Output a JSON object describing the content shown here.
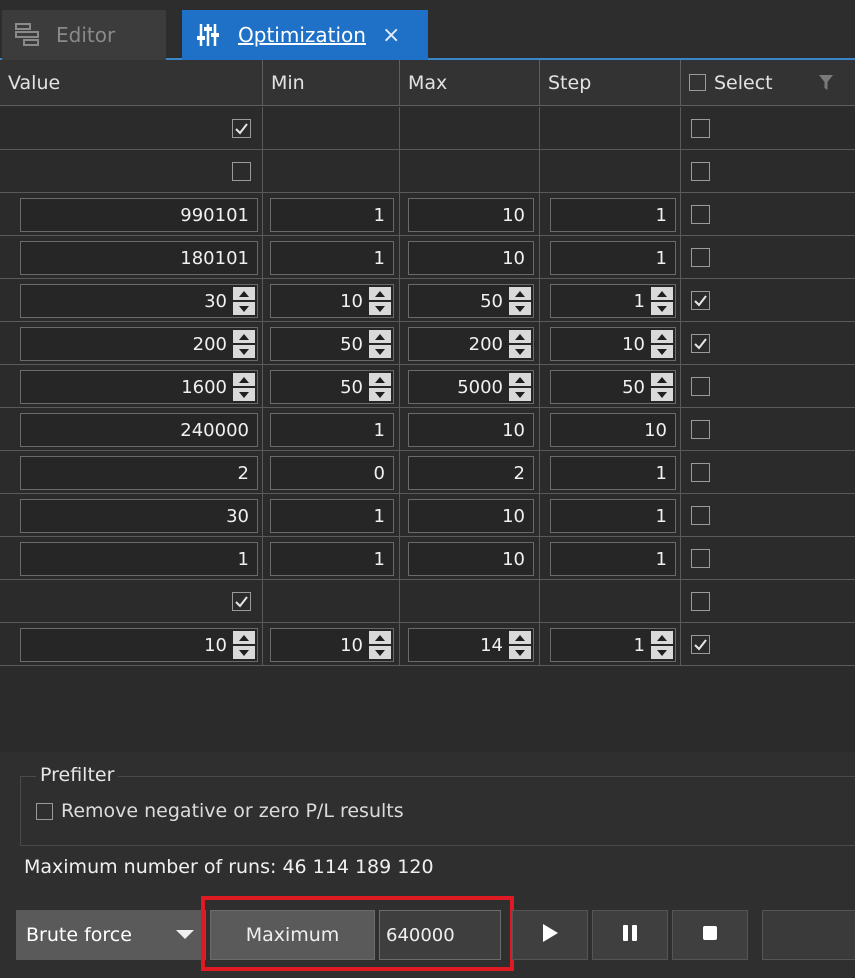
{
  "tabs": [
    {
      "label": "Editor",
      "icon": "editor-icon",
      "active": false
    },
    {
      "label": "Optimization",
      "icon": "sliders-icon",
      "active": true,
      "close": "×"
    }
  ],
  "columns": {
    "value": "Value",
    "min": "Min",
    "max": "Max",
    "step": "Step",
    "select": "Select"
  },
  "rows": [
    {
      "kind": "bool",
      "value": true,
      "select": false
    },
    {
      "kind": "bool",
      "value": false,
      "select": false
    },
    {
      "kind": "num",
      "value": "990101",
      "min": "1",
      "max": "10",
      "step": "1",
      "select": false,
      "spin": false
    },
    {
      "kind": "num",
      "value": "180101",
      "min": "1",
      "max": "10",
      "step": "1",
      "select": false,
      "spin": false
    },
    {
      "kind": "num",
      "value": "30",
      "min": "10",
      "max": "50",
      "step": "1",
      "select": true,
      "spin": true
    },
    {
      "kind": "num",
      "value": "200",
      "min": "50",
      "max": "200",
      "step": "10",
      "select": true,
      "spin": true
    },
    {
      "kind": "num",
      "value": "1600",
      "min": "50",
      "max": "5000",
      "step": "50",
      "select": false,
      "spin": true
    },
    {
      "kind": "num",
      "value": "240000",
      "min": "1",
      "max": "10",
      "step": "10",
      "select": false,
      "spin": false
    },
    {
      "kind": "num",
      "value": "2",
      "min": "0",
      "max": "2",
      "step": "1",
      "select": false,
      "spin": false
    },
    {
      "kind": "num",
      "value": "30",
      "min": "1",
      "max": "10",
      "step": "1",
      "select": false,
      "spin": false
    },
    {
      "kind": "num",
      "value": "1",
      "min": "1",
      "max": "10",
      "step": "1",
      "select": false,
      "spin": false
    },
    {
      "kind": "bool",
      "value": true,
      "select": false
    },
    {
      "kind": "num",
      "value": "10",
      "min": "10",
      "max": "14",
      "step": "1",
      "select": true,
      "spin": true
    }
  ],
  "prefilter": {
    "title": "Prefilter",
    "option": "Remove negative or zero P/L results",
    "checked": false
  },
  "runs_text": "Maximum number of runs: 46 114 189 120",
  "controls": {
    "algorithm": "Brute force",
    "mode": "Maximum",
    "max_value": "640000",
    "icons": [
      "play-icon",
      "pause-icon",
      "stop-icon"
    ]
  },
  "colors": {
    "accent": "#1f71c7",
    "highlight": "#e01a22"
  }
}
